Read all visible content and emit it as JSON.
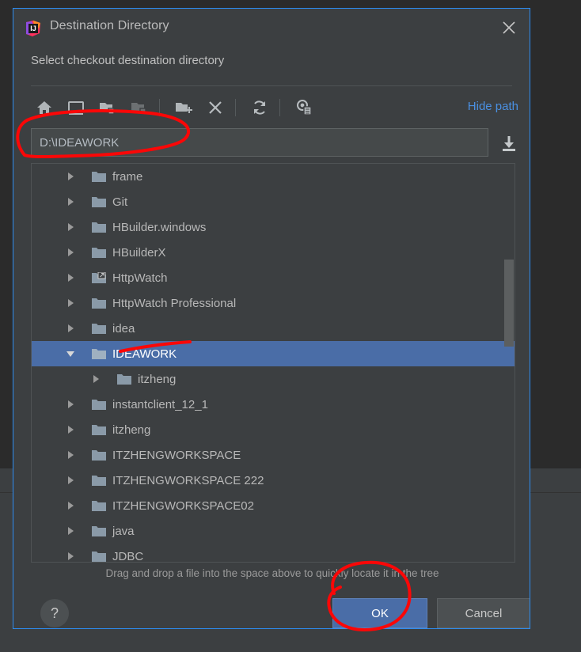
{
  "window": {
    "title": "Destination Directory",
    "close_icon": "close-icon",
    "logo_icon": "intellij-idea-logo"
  },
  "dialog": {
    "subtitle": "Select checkout destination directory",
    "hint": "Drag and drop a file into the space above to quickly locate it in the tree"
  },
  "toolbar": {
    "hide_path_label": "Hide path",
    "buttons": [
      {
        "name": "home-icon",
        "title": "Home",
        "enabled": true
      },
      {
        "name": "desktop-icon",
        "title": "Desktop",
        "enabled": true
      },
      {
        "name": "project-folder-icon",
        "title": "Project",
        "enabled": true
      },
      {
        "name": "module-folder-icon",
        "title": "Module",
        "enabled": false
      },
      {
        "name": "new-folder-icon",
        "title": "New Folder",
        "enabled": true
      },
      {
        "name": "delete-icon",
        "title": "Delete",
        "enabled": true
      },
      {
        "name": "refresh-icon",
        "title": "Refresh",
        "enabled": true
      },
      {
        "name": "show-hidden-icon",
        "title": "Show Hidden",
        "enabled": true
      }
    ]
  },
  "path_field": {
    "value": "D:\\IDEAWORK",
    "placeholder": "",
    "download_icon": "download-arrow-icon"
  },
  "tree": {
    "items": [
      {
        "label": "frame",
        "depth": 1,
        "expanded": false,
        "selected": false,
        "icon": "folder-icon"
      },
      {
        "label": "Git",
        "depth": 1,
        "expanded": false,
        "selected": false,
        "icon": "folder-icon"
      },
      {
        "label": "HBuilder.windows",
        "depth": 1,
        "expanded": false,
        "selected": false,
        "icon": "folder-icon"
      },
      {
        "label": "HBuilderX",
        "depth": 1,
        "expanded": false,
        "selected": false,
        "icon": "folder-icon"
      },
      {
        "label": "HttpWatch",
        "depth": 1,
        "expanded": false,
        "selected": false,
        "icon": "folder-symlink-icon"
      },
      {
        "label": "HttpWatch Professional",
        "depth": 1,
        "expanded": false,
        "selected": false,
        "icon": "folder-icon"
      },
      {
        "label": "idea",
        "depth": 1,
        "expanded": false,
        "selected": false,
        "icon": "folder-icon"
      },
      {
        "label": "IDEAWORK",
        "depth": 1,
        "expanded": true,
        "selected": true,
        "icon": "folder-icon"
      },
      {
        "label": "itzheng",
        "depth": 2,
        "expanded": false,
        "selected": false,
        "icon": "folder-icon"
      },
      {
        "label": "instantclient_12_1",
        "depth": 1,
        "expanded": false,
        "selected": false,
        "icon": "folder-icon"
      },
      {
        "label": "itzheng",
        "depth": 1,
        "expanded": false,
        "selected": false,
        "icon": "folder-icon"
      },
      {
        "label": "ITZHENGWORKSPACE",
        "depth": 1,
        "expanded": false,
        "selected": false,
        "icon": "folder-icon"
      },
      {
        "label": "ITZHENGWORKSPACE 222",
        "depth": 1,
        "expanded": false,
        "selected": false,
        "icon": "folder-icon"
      },
      {
        "label": "ITZHENGWORKSPACE02",
        "depth": 1,
        "expanded": false,
        "selected": false,
        "icon": "folder-icon"
      },
      {
        "label": "java",
        "depth": 1,
        "expanded": false,
        "selected": false,
        "icon": "folder-icon"
      },
      {
        "label": "JDBC",
        "depth": 1,
        "expanded": false,
        "selected": false,
        "icon": "folder-icon"
      }
    ],
    "scrollbar": {
      "thumb_top_pct": 24,
      "thumb_height_pct": 22
    }
  },
  "footer": {
    "help_label": "?",
    "ok_label": "OK",
    "cancel_label": "Cancel"
  },
  "colors": {
    "dialog_bg": "#3c3f41",
    "dialog_border": "#2d8cf0",
    "selection": "#4a6da7",
    "link": "#4a90e2",
    "text": "#b8b8b8",
    "annotation": "#fb0707",
    "folder": "#8a9aa8"
  },
  "annotations": {
    "shapes": [
      {
        "name": "path-field-circle",
        "note": "red ellipse around path text field"
      },
      {
        "name": "ideawork-underline",
        "note": "red underline under IDEAWORK tree item"
      },
      {
        "name": "ok-button-circle",
        "note": "red circle around OK button"
      }
    ]
  }
}
